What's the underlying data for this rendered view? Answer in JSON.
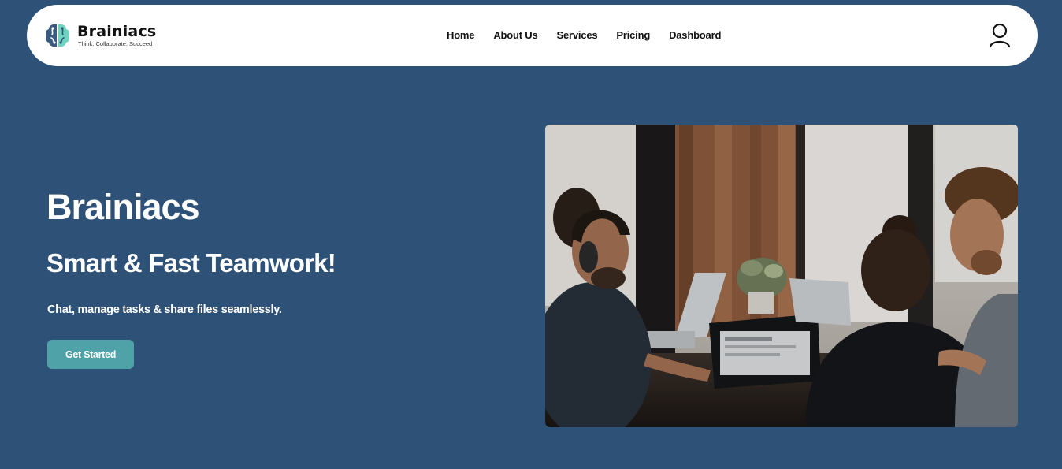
{
  "brand": {
    "name": "Brainiacs",
    "tagline": "Think. Collaborate. Succeed",
    "colors": {
      "primary_bg": "#2e5177",
      "accent": "#4ea2a8",
      "logo_dark": "#3b5a80",
      "logo_light": "#6fd4bf"
    }
  },
  "nav": {
    "items": [
      {
        "label": "Home"
      },
      {
        "label": "About Us"
      },
      {
        "label": "Services"
      },
      {
        "label": "Pricing"
      },
      {
        "label": "Dashboard"
      }
    ],
    "user_icon": "user-icon"
  },
  "hero": {
    "title": "Brainiacs",
    "subtitle": "Smart & Fast Teamwork!",
    "description": "Chat, manage tasks & share files seamlessly.",
    "cta_label": "Get Started",
    "image_subject": "people-working-on-laptops-photo"
  }
}
